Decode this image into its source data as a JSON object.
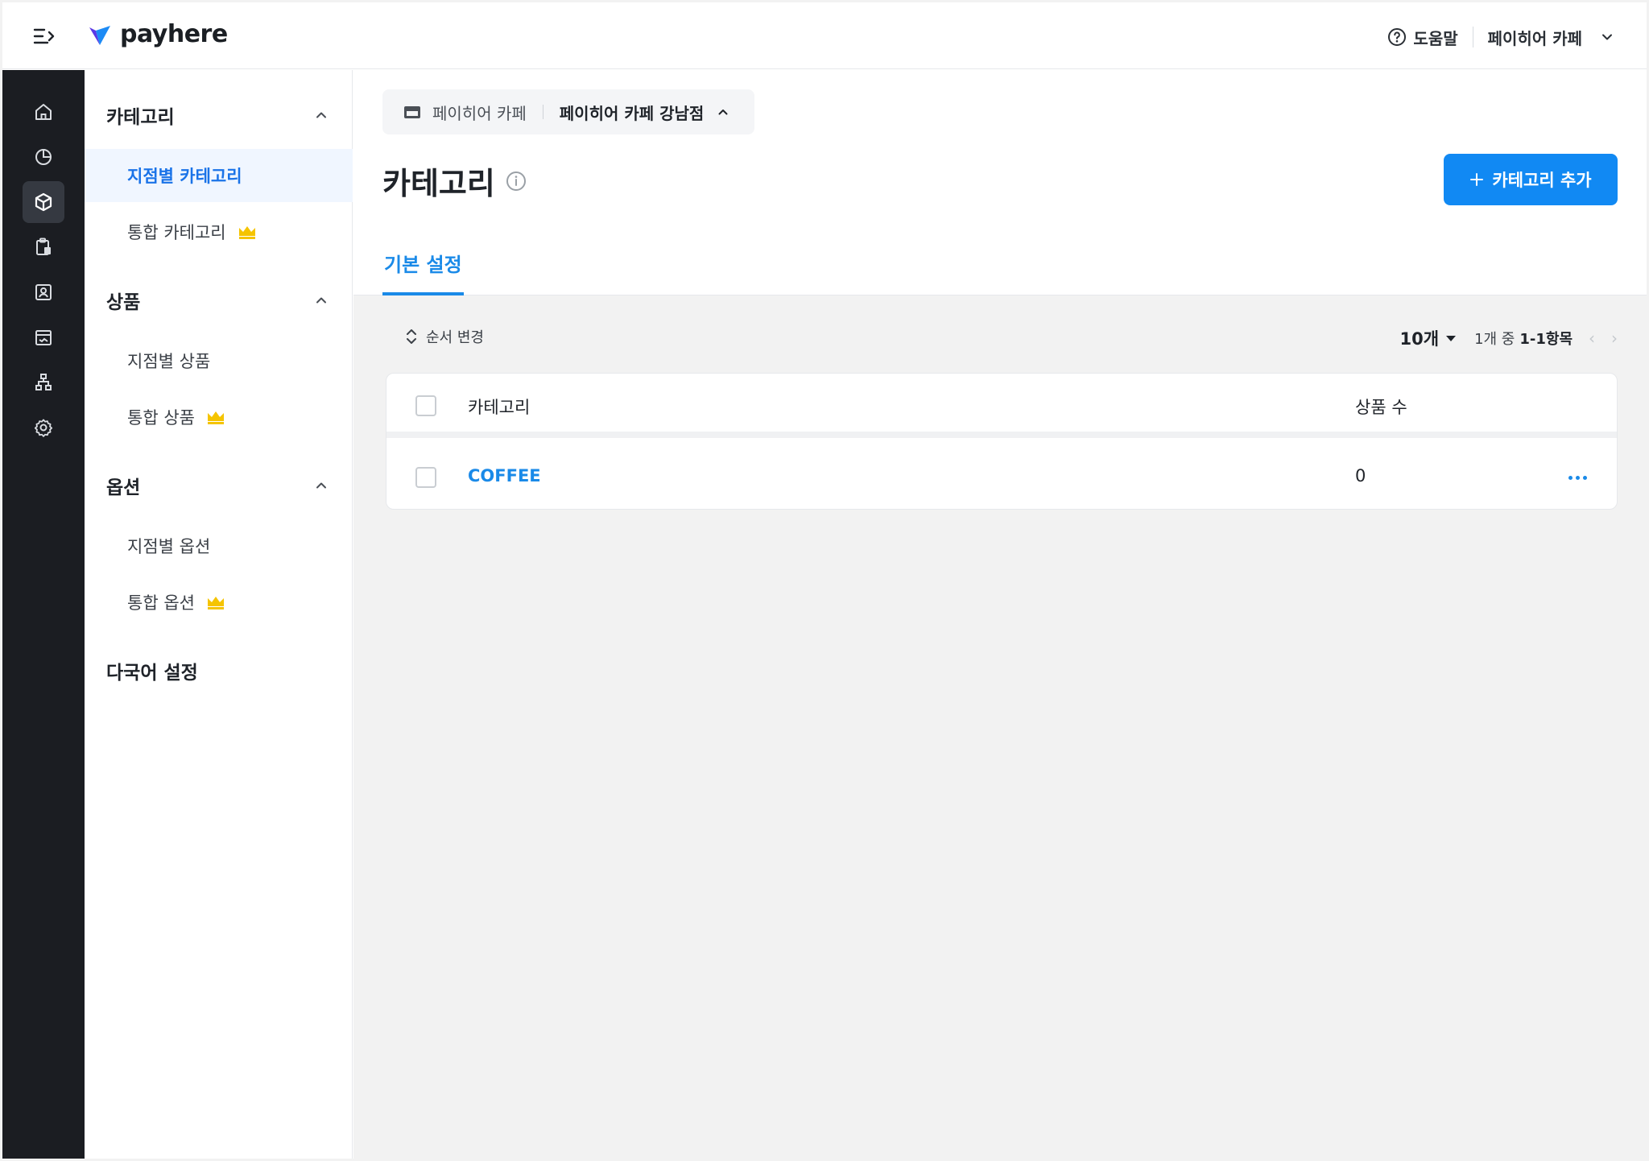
{
  "app": {
    "logo_text": "payhere"
  },
  "topbar": {
    "help_label": "도움말",
    "store_menu_label": "페이히어 카페"
  },
  "rail": {
    "items": [
      {
        "name": "home",
        "icon": "home-icon"
      },
      {
        "name": "analytics",
        "icon": "pie-chart-icon"
      },
      {
        "name": "products",
        "icon": "box-icon",
        "active": true
      },
      {
        "name": "orders",
        "icon": "clipboard-icon"
      },
      {
        "name": "customers",
        "icon": "contact-card-icon"
      },
      {
        "name": "stores",
        "icon": "storefront-icon"
      },
      {
        "name": "organization",
        "icon": "org-chart-icon"
      },
      {
        "name": "settings",
        "icon": "gear-icon"
      }
    ]
  },
  "submenu": {
    "category_section": "카테고리",
    "category_by_branch": "지점별 카테고리",
    "category_integrated": "통합 카테고리",
    "product_section": "상품",
    "product_by_branch": "지점별 상품",
    "product_integrated": "통합 상품",
    "option_section": "옵션",
    "option_by_branch": "지점별 옵션",
    "option_integrated": "통합 옵션",
    "multilang": "다국어 설정"
  },
  "store_selector": {
    "brand": "페이히어 카페",
    "branch": "페이히어 카페 강남점"
  },
  "page": {
    "title": "카테고리",
    "add_button": "카테고리 추가",
    "tab": "기본 설정"
  },
  "toolbar": {
    "reorder_label": "순서 변경",
    "page_size": "10개",
    "page_info_prefix": "1개 중",
    "page_info_range": "1-1항목"
  },
  "table": {
    "columns": {
      "category": "카테고리",
      "product_count": "상품 수"
    },
    "rows": [
      {
        "category": "COFFEE",
        "product_count": "0"
      }
    ]
  },
  "colors": {
    "accent": "#1189f3",
    "rail_bg": "#1b1d22",
    "crown": "#f5c400"
  }
}
